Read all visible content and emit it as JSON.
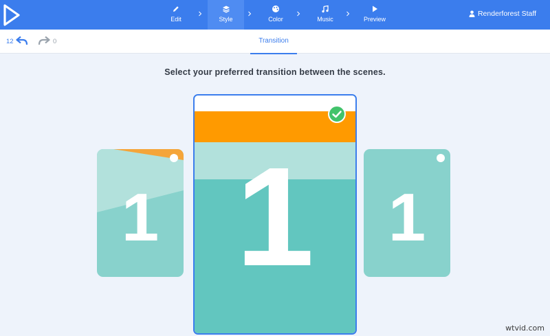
{
  "topbar": {
    "steps": [
      {
        "label": "Edit",
        "icon": "pencil-icon"
      },
      {
        "label": "Style",
        "icon": "layers-icon",
        "active": true
      },
      {
        "label": "Color",
        "icon": "palette-icon"
      },
      {
        "label": "Music",
        "icon": "music-note-icon"
      },
      {
        "label": "Preview",
        "icon": "play-icon"
      }
    ],
    "user": "Renderforest Staff"
  },
  "subbar": {
    "undo_count": "12",
    "redo_count": "0",
    "active_tab": "Transition"
  },
  "main": {
    "heading": "Select your preferred transition between the scenes.",
    "options": [
      {
        "number": "1",
        "selected": false
      },
      {
        "number": "1",
        "selected": true
      },
      {
        "number": "1",
        "selected": false
      }
    ]
  },
  "watermark": "wtvid.com",
  "colors": {
    "accent": "#3b7ded",
    "orange": "#ff9a00",
    "teal_light": "#b2e1dc",
    "teal": "#62c6bf",
    "teal_soft": "#88d2cc",
    "check_green": "#42c36b"
  }
}
